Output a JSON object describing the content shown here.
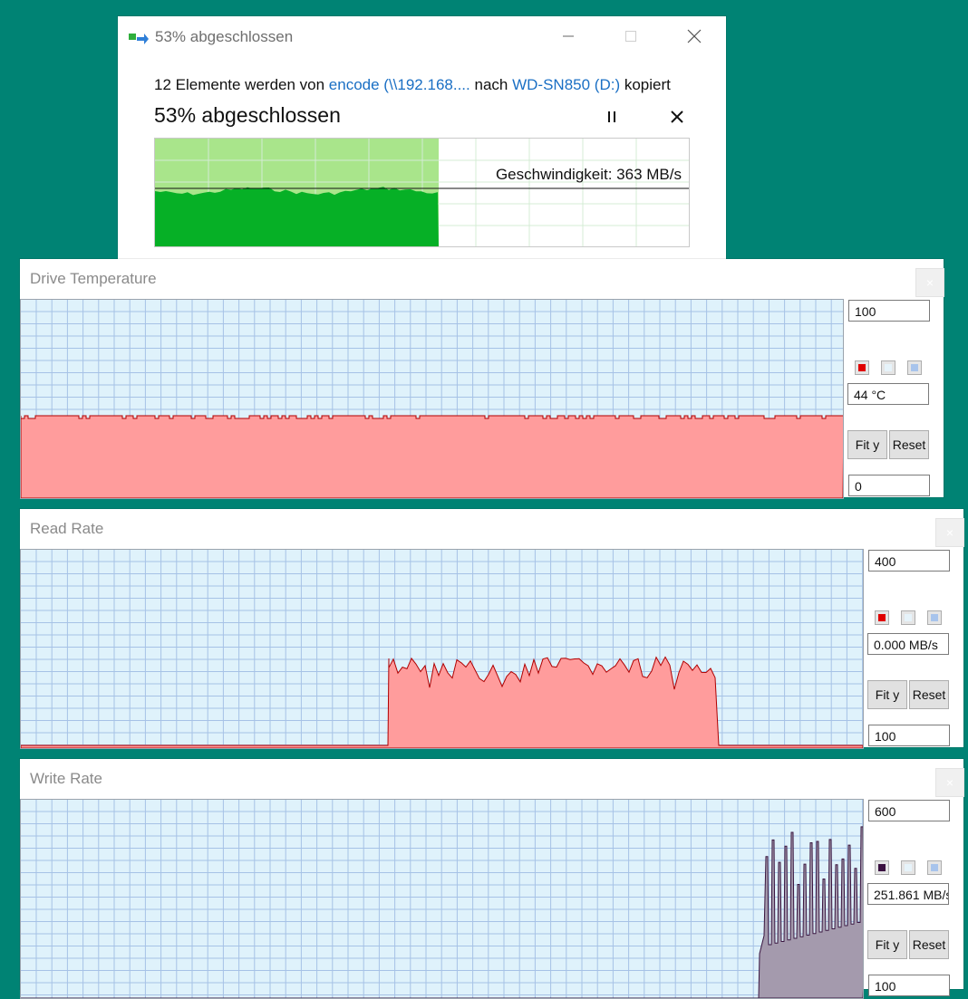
{
  "copy_dialog": {
    "title": "53% abgeschlossen",
    "desc_prefix": "12 Elemente werden von",
    "source": "encode (\\\\192.168....",
    "desc_mid": "nach",
    "destination": "WD-SN850 (D:)",
    "desc_suffix": "kopiert",
    "progress_label": "53% abgeschlossen",
    "progress": 0.53,
    "speed_label": "Geschwindigkeit: 363 MB/s",
    "minimize_icon": "minimize-icon",
    "maximize_icon": "maximize-icon",
    "close_icon": "close-icon",
    "pause_icon": "pause-icon",
    "cancel_icon": "close-icon"
  },
  "colors": {
    "desktop": "#008374",
    "graph_fill": "#06b026",
    "graph_fill_light": "#a9e58b",
    "plot_bg": "#dff2fb",
    "plot_grid": "#a6c2e6",
    "temp_fill": "#ff9c9c",
    "temp_line": "#b00000",
    "write_fill": "#a49aad",
    "write_line": "#3a1640"
  },
  "drive_temp": {
    "title": "Drive Temperature",
    "max": "100",
    "current": "44 °C",
    "min": "0",
    "fit_label": "Fit y",
    "reset_label": "Reset",
    "swatch_colors": [
      "#e00000",
      "#e6f3fa",
      "#a8c4ec"
    ]
  },
  "read_rate": {
    "title": "Read Rate",
    "max": "400",
    "current": "0.000 MB/s",
    "min": "100",
    "fit_label": "Fit y",
    "reset_label": "Reset",
    "swatch_colors": [
      "#e00000",
      "#e6f3fa",
      "#a8c4ec"
    ]
  },
  "write_rate": {
    "title": "Write Rate",
    "max": "600",
    "current": "251.861 MB/s",
    "min": "100",
    "fit_label": "Fit y",
    "reset_label": "Reset",
    "swatch_colors": [
      "#3a1040",
      "#e6f3fa",
      "#a8c4ec"
    ]
  }
}
